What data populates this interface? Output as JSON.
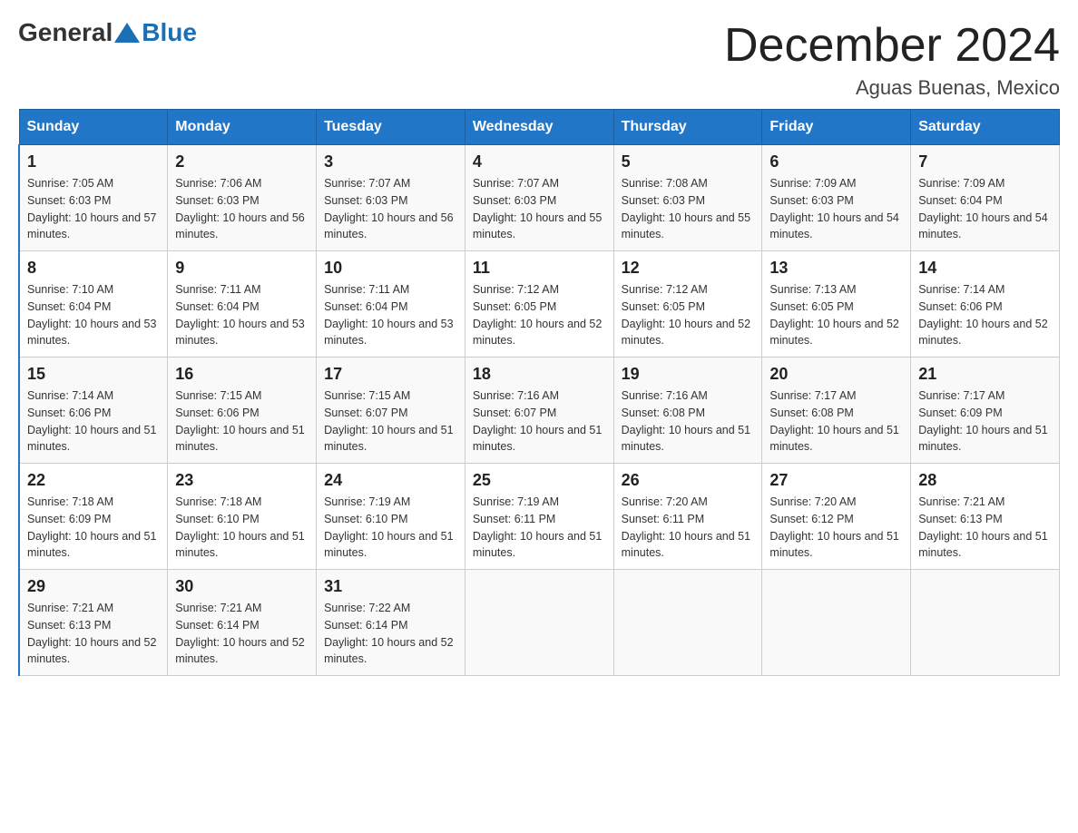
{
  "logo": {
    "general": "General",
    "blue": "Blue"
  },
  "title": "December 2024",
  "location": "Aguas Buenas, Mexico",
  "days_of_week": [
    "Sunday",
    "Monday",
    "Tuesday",
    "Wednesday",
    "Thursday",
    "Friday",
    "Saturday"
  ],
  "weeks": [
    [
      {
        "day": "1",
        "sunrise": "7:05 AM",
        "sunset": "6:03 PM",
        "daylight": "10 hours and 57 minutes."
      },
      {
        "day": "2",
        "sunrise": "7:06 AM",
        "sunset": "6:03 PM",
        "daylight": "10 hours and 56 minutes."
      },
      {
        "day": "3",
        "sunrise": "7:07 AM",
        "sunset": "6:03 PM",
        "daylight": "10 hours and 56 minutes."
      },
      {
        "day": "4",
        "sunrise": "7:07 AM",
        "sunset": "6:03 PM",
        "daylight": "10 hours and 55 minutes."
      },
      {
        "day": "5",
        "sunrise": "7:08 AM",
        "sunset": "6:03 PM",
        "daylight": "10 hours and 55 minutes."
      },
      {
        "day": "6",
        "sunrise": "7:09 AM",
        "sunset": "6:03 PM",
        "daylight": "10 hours and 54 minutes."
      },
      {
        "day": "7",
        "sunrise": "7:09 AM",
        "sunset": "6:04 PM",
        "daylight": "10 hours and 54 minutes."
      }
    ],
    [
      {
        "day": "8",
        "sunrise": "7:10 AM",
        "sunset": "6:04 PM",
        "daylight": "10 hours and 53 minutes."
      },
      {
        "day": "9",
        "sunrise": "7:11 AM",
        "sunset": "6:04 PM",
        "daylight": "10 hours and 53 minutes."
      },
      {
        "day": "10",
        "sunrise": "7:11 AM",
        "sunset": "6:04 PM",
        "daylight": "10 hours and 53 minutes."
      },
      {
        "day": "11",
        "sunrise": "7:12 AM",
        "sunset": "6:05 PM",
        "daylight": "10 hours and 52 minutes."
      },
      {
        "day": "12",
        "sunrise": "7:12 AM",
        "sunset": "6:05 PM",
        "daylight": "10 hours and 52 minutes."
      },
      {
        "day": "13",
        "sunrise": "7:13 AM",
        "sunset": "6:05 PM",
        "daylight": "10 hours and 52 minutes."
      },
      {
        "day": "14",
        "sunrise": "7:14 AM",
        "sunset": "6:06 PM",
        "daylight": "10 hours and 52 minutes."
      }
    ],
    [
      {
        "day": "15",
        "sunrise": "7:14 AM",
        "sunset": "6:06 PM",
        "daylight": "10 hours and 51 minutes."
      },
      {
        "day": "16",
        "sunrise": "7:15 AM",
        "sunset": "6:06 PM",
        "daylight": "10 hours and 51 minutes."
      },
      {
        "day": "17",
        "sunrise": "7:15 AM",
        "sunset": "6:07 PM",
        "daylight": "10 hours and 51 minutes."
      },
      {
        "day": "18",
        "sunrise": "7:16 AM",
        "sunset": "6:07 PM",
        "daylight": "10 hours and 51 minutes."
      },
      {
        "day": "19",
        "sunrise": "7:16 AM",
        "sunset": "6:08 PM",
        "daylight": "10 hours and 51 minutes."
      },
      {
        "day": "20",
        "sunrise": "7:17 AM",
        "sunset": "6:08 PM",
        "daylight": "10 hours and 51 minutes."
      },
      {
        "day": "21",
        "sunrise": "7:17 AM",
        "sunset": "6:09 PM",
        "daylight": "10 hours and 51 minutes."
      }
    ],
    [
      {
        "day": "22",
        "sunrise": "7:18 AM",
        "sunset": "6:09 PM",
        "daylight": "10 hours and 51 minutes."
      },
      {
        "day": "23",
        "sunrise": "7:18 AM",
        "sunset": "6:10 PM",
        "daylight": "10 hours and 51 minutes."
      },
      {
        "day": "24",
        "sunrise": "7:19 AM",
        "sunset": "6:10 PM",
        "daylight": "10 hours and 51 minutes."
      },
      {
        "day": "25",
        "sunrise": "7:19 AM",
        "sunset": "6:11 PM",
        "daylight": "10 hours and 51 minutes."
      },
      {
        "day": "26",
        "sunrise": "7:20 AM",
        "sunset": "6:11 PM",
        "daylight": "10 hours and 51 minutes."
      },
      {
        "day": "27",
        "sunrise": "7:20 AM",
        "sunset": "6:12 PM",
        "daylight": "10 hours and 51 minutes."
      },
      {
        "day": "28",
        "sunrise": "7:21 AM",
        "sunset": "6:13 PM",
        "daylight": "10 hours and 51 minutes."
      }
    ],
    [
      {
        "day": "29",
        "sunrise": "7:21 AM",
        "sunset": "6:13 PM",
        "daylight": "10 hours and 52 minutes."
      },
      {
        "day": "30",
        "sunrise": "7:21 AM",
        "sunset": "6:14 PM",
        "daylight": "10 hours and 52 minutes."
      },
      {
        "day": "31",
        "sunrise": "7:22 AM",
        "sunset": "6:14 PM",
        "daylight": "10 hours and 52 minutes."
      },
      null,
      null,
      null,
      null
    ]
  ]
}
